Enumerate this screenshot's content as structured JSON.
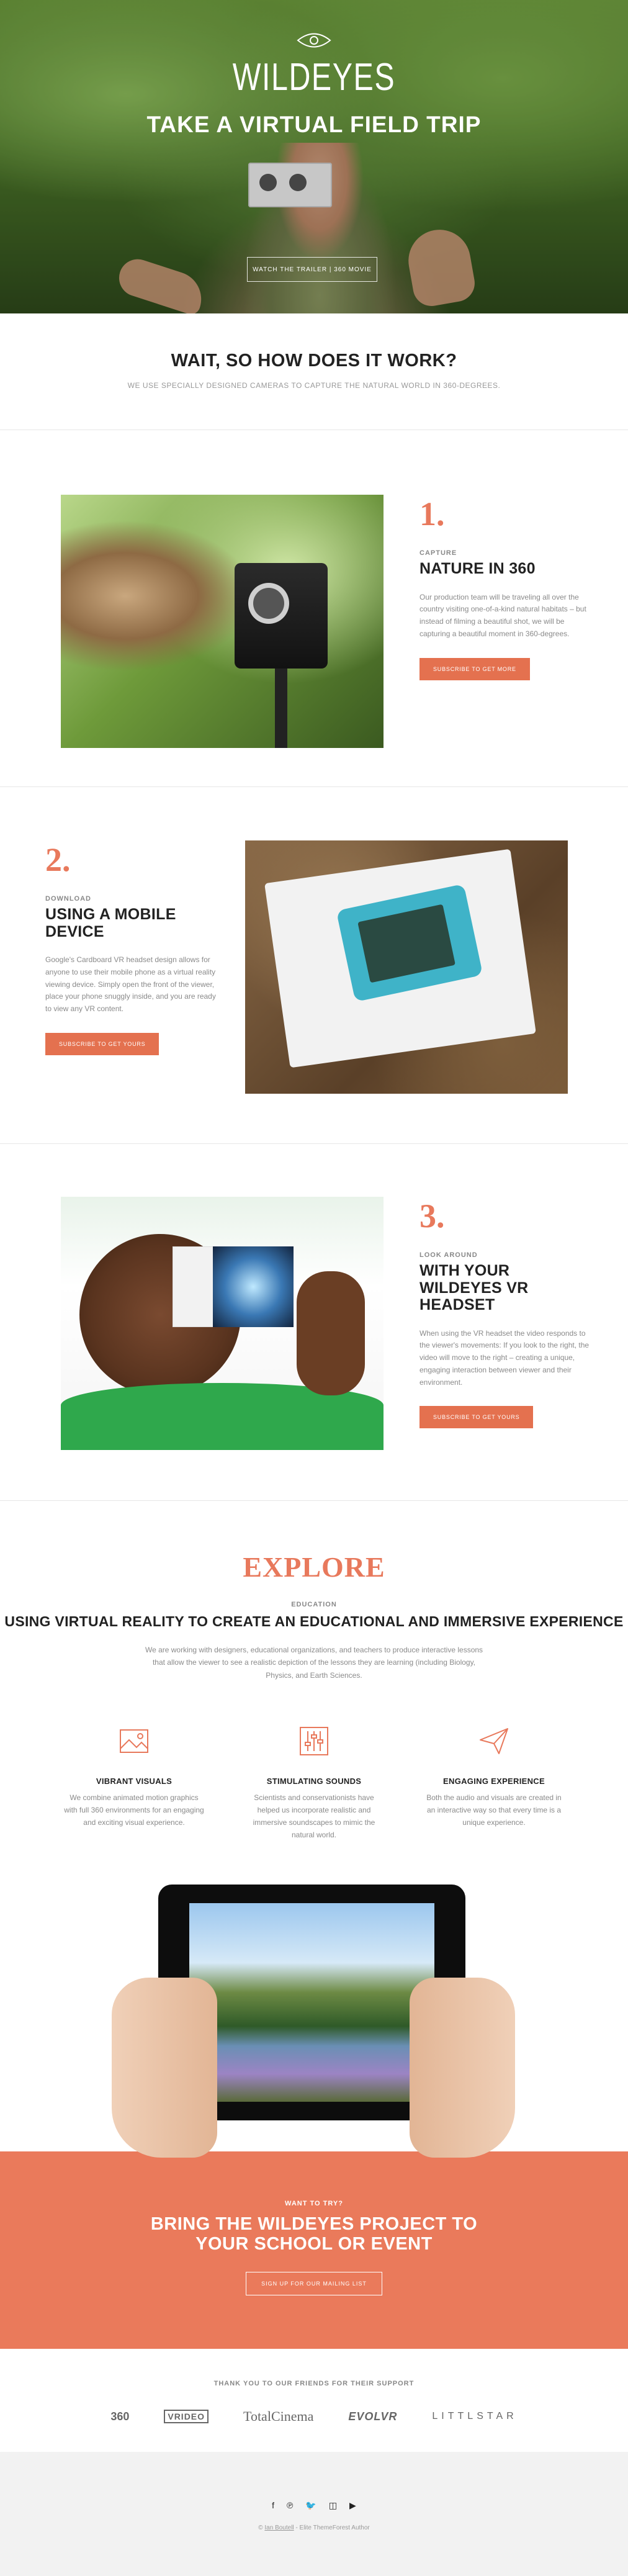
{
  "hero": {
    "logo_text": "WILDEYES",
    "title": "TAKE A VIRTUAL FIELD TRIP",
    "button": "WATCH THE TRAILER | 360 MOVIE"
  },
  "how": {
    "title": "WAIT, SO HOW DOES IT WORK?",
    "subtitle": "WE USE SPECIALLY DESIGNED CAMERAS TO CAPTURE THE NATURAL WORLD IN 360-DEGREES."
  },
  "steps": [
    {
      "number": "1.",
      "eyebrow": "CAPTURE",
      "title": "NATURE IN 360",
      "body": "Our production team will be traveling all over the country visiting one-of-a-kind natural habitats – but instead of filming a beautiful shot, we will be capturing a beautiful moment in 360-degrees.",
      "button": "SUBSCRIBE TO GET MORE"
    },
    {
      "number": "2.",
      "eyebrow": "DOWNLOAD",
      "title": "USING A MOBILE DEVICE",
      "body": "Google's Cardboard VR headset design allows for anyone to use their mobile phone as a virtual reality viewing device. Simply open the front of the viewer, place your phone snuggly inside, and you are ready to view any VR content.",
      "button": "SUBSCRIBE TO GET YOURS"
    },
    {
      "number": "3.",
      "eyebrow": "LOOK AROUND",
      "title": "WITH YOUR WILDEYES VR HEADSET",
      "body": "When using the VR headset the video responds to the viewer's movements: If you look to the right, the video will move to the right – creating a unique, engaging interaction between viewer and their environment.",
      "button": "SUBSCRIBE TO GET YOURS"
    }
  ],
  "explore": {
    "title": "EXPLORE",
    "eyebrow": "EDUCATION",
    "heading": "USING VIRTUAL REALITY TO CREATE AN EDUCATIONAL AND IMMERSIVE EXPERIENCE",
    "body": "We are working with designers, educational organizations, and teachers to produce interactive lessons that allow the viewer to see a realistic depiction of the lessons they are learning (including Biology, Physics, and Earth Sciences.",
    "features": [
      {
        "icon": "image-icon",
        "title": "VIBRANT VISUALS",
        "body": "We combine animated motion graphics with full 360 environments for an engaging and exciting visual experience."
      },
      {
        "icon": "sliders-icon",
        "title": "STIMULATING SOUNDS",
        "body": "Scientists and conservationists have helped us incorporate realistic and immersive soundscapes to mimic the natural world."
      },
      {
        "icon": "paper-plane-icon",
        "title": "ENGAGING EXPERIENCE",
        "body": "Both the audio and visuals are created in an interactive way so that every time is a unique experience."
      }
    ]
  },
  "cta": {
    "eyebrow": "WANT TO TRY?",
    "title_line1": "BRING THE WILDEYES PROJECT TO",
    "title_line2": "YOUR SCHOOL OR EVENT",
    "button": "SIGN UP FOR OUR MAILING LIST"
  },
  "partners": {
    "title": "THANK YOU TO OUR FRIENDS FOR THEIR SUPPORT",
    "logos": [
      "360",
      "VRIDEO",
      "TotalCinema",
      "EVOLVR",
      "LITTLSTAR"
    ]
  },
  "footer": {
    "social": [
      "facebook-icon",
      "pinterest-icon",
      "twitter-icon",
      "instagram-icon",
      "youtube-icon"
    ],
    "credit_prefix": "© ",
    "credit_link": "Ian Boutell",
    "credit_suffix": " - Elite ThemeForest Author"
  },
  "colors": {
    "accent": "#e8795c",
    "cta_bg": "#ea7a5b",
    "footer_bg": "#f2f2f2"
  }
}
